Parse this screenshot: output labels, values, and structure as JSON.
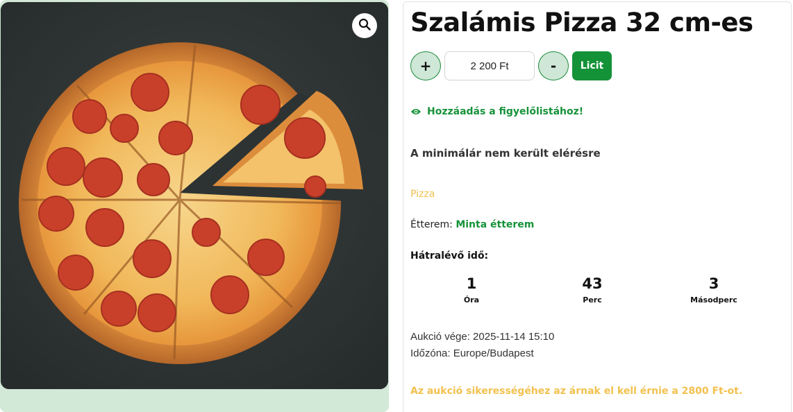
{
  "gallery": {
    "image_alt": "Szalámis Pizza",
    "zoom_icon": "search-icon"
  },
  "product": {
    "title": "Szalámis Pizza 32 cm-es",
    "bid": {
      "plus_label": "+",
      "minus_label": "-",
      "price_value": "2 200 Ft",
      "submit_label": "Licit"
    },
    "watchlist": {
      "icon": "eye-icon",
      "label": "Hozzáadás a figyelőlistához!"
    },
    "reserve_status": "A minimálár nem került elérésre",
    "category": "Pizza",
    "restaurant": {
      "label": "Étterem:",
      "name": "Minta étterem"
    },
    "remaining_label": "Hátralévő idő:",
    "countdown": [
      {
        "value": "1",
        "unit": "Óra"
      },
      {
        "value": "43",
        "unit": "Perc"
      },
      {
        "value": "3",
        "unit": "Másodperc"
      }
    ],
    "auction_end": "Aukció vége: 2025-11-14 15:10",
    "timezone": "Időzóna: Europe/Budapest",
    "notice": "Az aukció sikerességéhez az árnak el kell érnie a 2800 Ft-ot."
  },
  "colors": {
    "accent_green": "#149238",
    "link_green": "#17923a",
    "light_green": "#cfe7d6",
    "warning_yellow": "#f2c14e"
  }
}
